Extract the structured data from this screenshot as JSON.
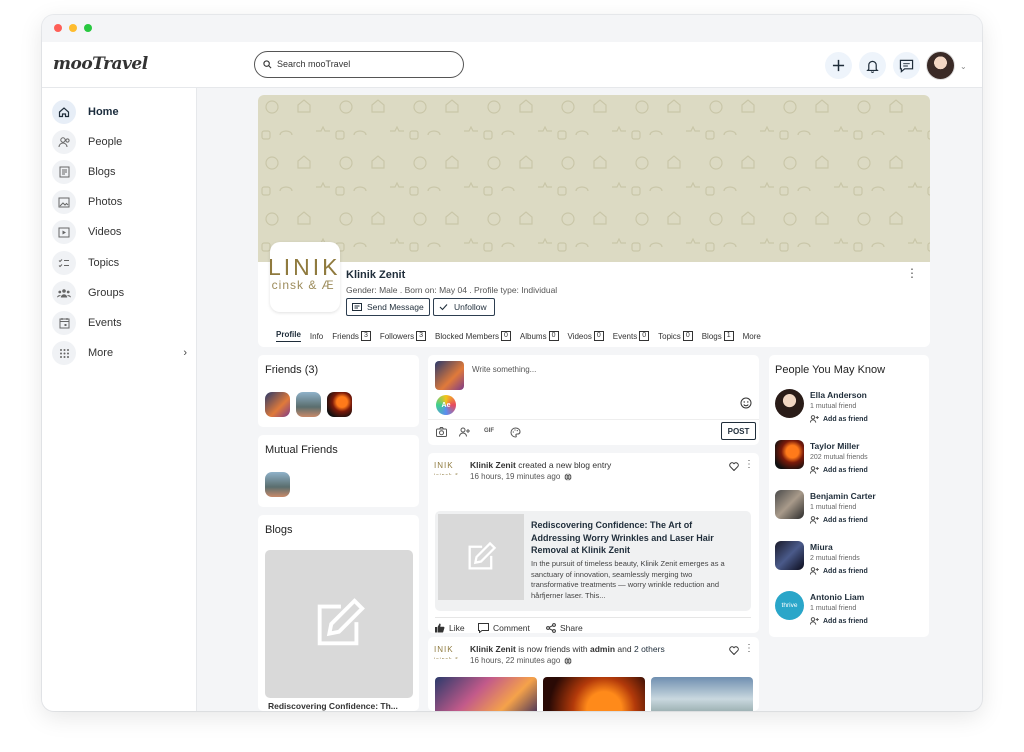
{
  "app": {
    "logo": "mooTravel"
  },
  "search": {
    "placeholder": "Search mooTravel"
  },
  "sidebar": {
    "items": [
      {
        "label": "Home"
      },
      {
        "label": "People"
      },
      {
        "label": "Blogs"
      },
      {
        "label": "Photos"
      },
      {
        "label": "Videos"
      },
      {
        "label": "Topics"
      },
      {
        "label": "Groups"
      },
      {
        "label": "Events"
      },
      {
        "label": "More"
      }
    ]
  },
  "profile": {
    "logo_line1": "LINIK",
    "logo_line2": "icinsk & Æ",
    "name": "Klinik Zenit",
    "meta": "Gender: Male  .  Born on: May 04  .  Profile type: Individual",
    "send_message": "Send Message",
    "unfollow": "Unfollow",
    "tabs": [
      {
        "label": "Profile",
        "count": ""
      },
      {
        "label": "Info",
        "count": ""
      },
      {
        "label": "Friends",
        "count": "3"
      },
      {
        "label": "Followers",
        "count": "3"
      },
      {
        "label": "Blocked Members",
        "count": "0"
      },
      {
        "label": "Albums",
        "count": "0"
      },
      {
        "label": "Videos",
        "count": "0"
      },
      {
        "label": "Events",
        "count": "0"
      },
      {
        "label": "Topics",
        "count": "0"
      },
      {
        "label": "Blogs",
        "count": "1"
      },
      {
        "label": "More",
        "count": ""
      }
    ]
  },
  "friends_box": {
    "title": "Friends (3)"
  },
  "mutual_box": {
    "title": "Mutual Friends"
  },
  "blogs_box": {
    "title": "Blogs",
    "caption": "Rediscovering Confidence: Th..."
  },
  "composer": {
    "placeholder": "Write something...",
    "tag": "Ae",
    "gif": "GIF",
    "post": "POST"
  },
  "post1": {
    "author": "Klinik Zenit",
    "action": "created a new blog entry",
    "time": "16 hours, 19 minutes ago",
    "title": "Rediscovering Confidence: The Art of Addressing Worry Wrinkles and Laser Hair Removal at Klinik Zenit",
    "excerpt": "In the pursuit of timeless beauty, Klinik Zenit emerges as a sanctuary of innovation, seamlessly merging two transformative treatments — worry wrinkle reduction and hårfjerner laser. This...",
    "like": "Like",
    "comment": "Comment",
    "share": "Share"
  },
  "post2": {
    "author": "Klinik Zenit",
    "action_a": "is now friends with",
    "friend": "admin",
    "and": "and",
    "others": "2 others",
    "time": "16 hours, 22 minutes ago"
  },
  "pymk": {
    "title": "People You May Know",
    "add_label": "Add as friend",
    "people": [
      {
        "name": "Ella Anderson",
        "mutual": "1 mutual friend"
      },
      {
        "name": "Taylor Miller",
        "mutual": "202 mutual friends"
      },
      {
        "name": "Benjamin Carter",
        "mutual": "1 mutual friend"
      },
      {
        "name": "Miura",
        "mutual": "2 mutual friends"
      },
      {
        "name": "Antonio Liam",
        "mutual": "1 mutual friend",
        "avatar_text": "thrive"
      }
    ]
  },
  "colors": {
    "accent": "#1f2d3a",
    "cover": "#dcdac3",
    "link": "#1a5fb4"
  }
}
